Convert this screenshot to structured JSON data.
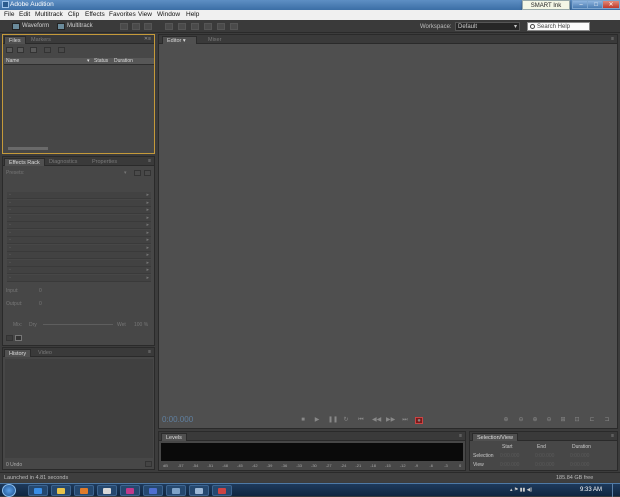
{
  "window": {
    "title": "Adobe Audition",
    "min_glyph": "–",
    "max_glyph": "□",
    "close_glyph": "✕"
  },
  "smart_ink": "SMART Ink",
  "menu": [
    "File",
    "Edit",
    "Multitrack",
    "Clip",
    "Effects",
    "Favorites",
    "View",
    "Window",
    "Help"
  ],
  "toolbar": {
    "waveform_label": "Waveform",
    "multitrack_label": "Multitrack",
    "workspace_label": "Workspace:",
    "workspace_value": "Default",
    "search_placeholder": "Search Help"
  },
  "files_panel": {
    "tabs": [
      "Files",
      "Markers"
    ],
    "columns": {
      "name": "Name",
      "status": "Status",
      "duration": "Duration"
    }
  },
  "effects_panel": {
    "tabs": [
      "Effects Rack",
      "Diagnostics",
      "Properties"
    ],
    "presets_label": "Presets:",
    "row_count": 12,
    "input_label": "Input:",
    "output_label": "Output:",
    "gain_left": "0",
    "gain_right": "0",
    "mix_label": "Mix:",
    "dry_label": "Dry",
    "wet_label": "Wet",
    "mix_value": "100 %"
  },
  "history_panel": {
    "tabs": [
      "History",
      "Video"
    ],
    "undo_count": "0 Undo"
  },
  "editor_panel": {
    "tabs": [
      "Editor",
      "Mixer"
    ],
    "time": "0:00.000"
  },
  "levels_panel": {
    "tab": "Levels",
    "scale": [
      "dB",
      "-57",
      "-54",
      "-51",
      "-48",
      "-45",
      "-42",
      "-39",
      "-36",
      "-33",
      "-30",
      "-27",
      "-24",
      "-21",
      "-18",
      "-15",
      "-12",
      "-9",
      "-6",
      "-3",
      "0"
    ]
  },
  "selection_panel": {
    "tab": "Selection/View",
    "headers": [
      "Start",
      "End",
      "Duration"
    ],
    "rows": [
      {
        "label": "Selection",
        "start": "0:00.000",
        "end": "0:00.000",
        "duration": "0:00.000"
      },
      {
        "label": "View",
        "start": "0:00.000",
        "end": "0:00.000",
        "duration": "0:00.000"
      }
    ]
  },
  "status": {
    "message": "Launched in 4.81 seconds",
    "disk": "185.84 GB free"
  },
  "taskbar": {
    "time": "9:33 AM",
    "icons": [
      "ie-icon",
      "explorer-icon",
      "media-player-icon",
      "chrome-icon",
      "presentation-icon",
      "audition-icon",
      "window-icon",
      "window-icon-2",
      "paint-icon"
    ]
  }
}
